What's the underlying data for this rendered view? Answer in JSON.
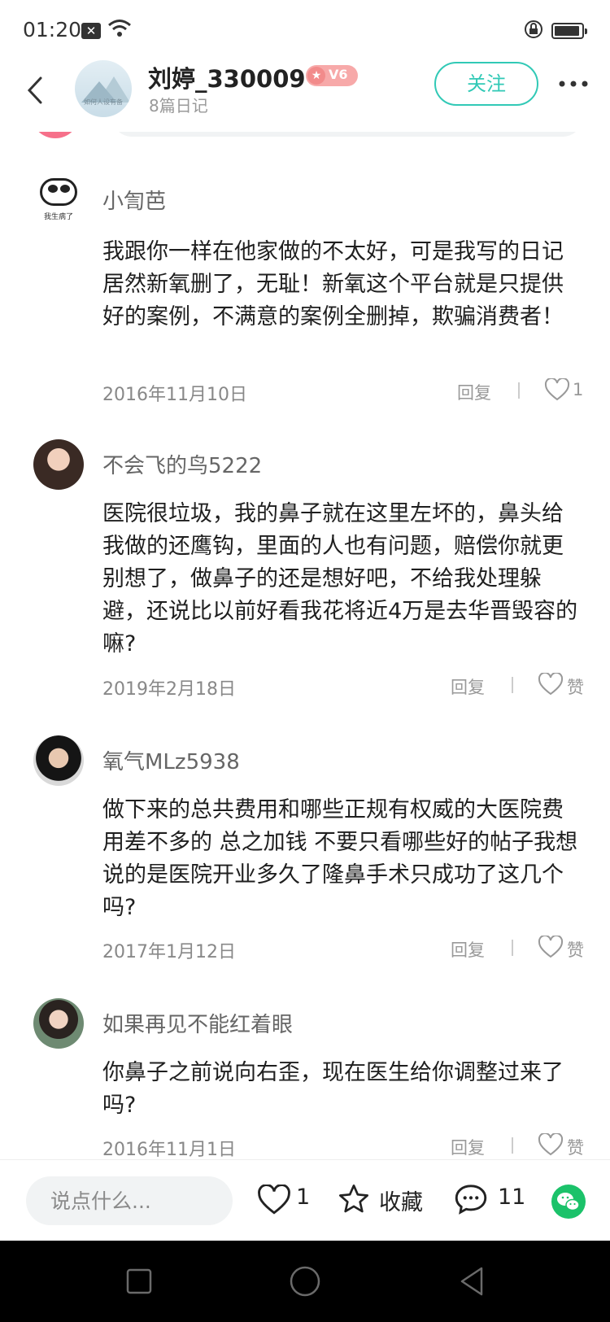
{
  "status_bar": {
    "time": "01:20",
    "notif_badge": "✕"
  },
  "header": {
    "username": "刘婷_330009",
    "badge": "V6",
    "subtitle": "8篇日记",
    "follow_label": "关注",
    "avatar_caption": "如何人设有备"
  },
  "comments": [
    {
      "name": "小訇芭",
      "avatar_caption": "我生病了",
      "text": "我跟你一样在他家做的不太好，可是我写的日记居然新氧删了，无耻！新氧这个平台就是只提供好的案例，不满意的案例全删掉，欺骗消费者！",
      "date": "2016年11月10日",
      "reply_label": "回复",
      "like_label": "1"
    },
    {
      "name": "不会飞的鸟5222",
      "text": "医院很垃圾，我的鼻子就在这里左坏的，鼻头给我做的还鹰钩，里面的人也有问题，赔偿你就更别想了，做鼻子的还是想好吧，不给我处理躲避，还说比以前好看我花将近4万是去华晋毁容的嘛?",
      "date": "2019年2月18日",
      "reply_label": "回复",
      "like_label": "赞"
    },
    {
      "name": "氧气MLz5938",
      "text": "做下来的总共费用和哪些正规有权威的大医院费用差不多的 总之加钱 不要只看哪些好的帖子我想说的是医院开业多久了隆鼻手术只成功了这几个吗?",
      "date": "2017年1月12日",
      "reply_label": "回复",
      "like_label": "赞"
    },
    {
      "name": "如果再见不能红着眼",
      "text": "你鼻子之前说向右歪，现在医生给你调整过来了吗?",
      "date": "2016年11月1日",
      "reply_label": "回复",
      "like_label": "赞"
    }
  ],
  "bottom_bar": {
    "input_placeholder": "说点什么...",
    "like_count": "1",
    "favorite_label": "收藏",
    "comment_count": "11"
  },
  "colors": {
    "accent": "#31c9b6",
    "badge": "#f7a9a9",
    "wechat": "#1bc26a"
  }
}
